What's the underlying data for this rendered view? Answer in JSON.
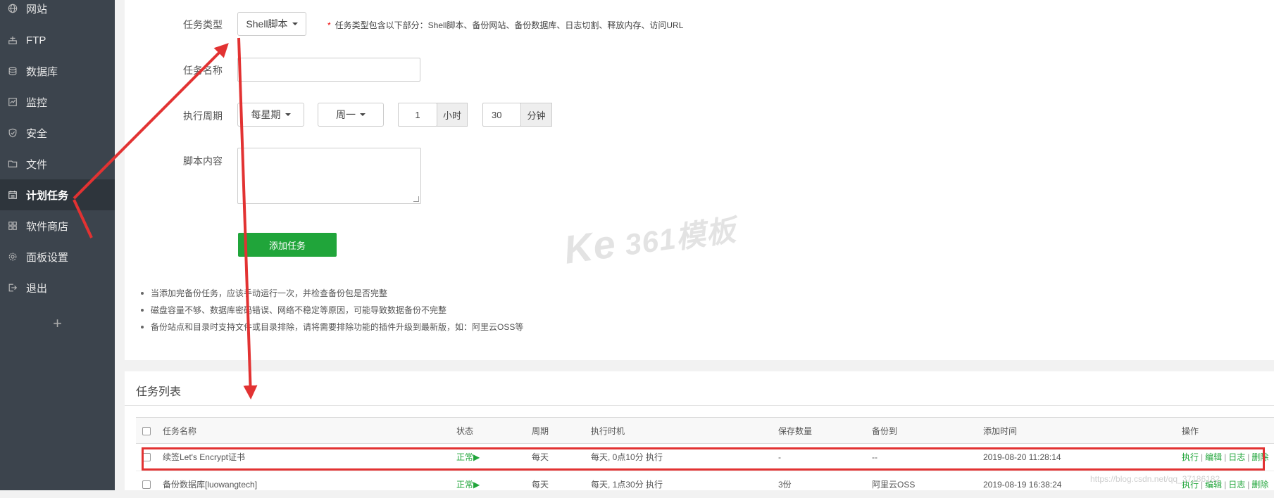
{
  "sidebar": {
    "items": [
      {
        "label": "网站",
        "icon": "globe-icon"
      },
      {
        "label": "FTP",
        "icon": "ftp-icon"
      },
      {
        "label": "数据库",
        "icon": "database-icon"
      },
      {
        "label": "监控",
        "icon": "monitor-icon"
      },
      {
        "label": "安全",
        "icon": "shield-icon"
      },
      {
        "label": "文件",
        "icon": "folder-icon"
      },
      {
        "label": "计划任务",
        "icon": "calendar-icon",
        "active": true
      },
      {
        "label": "软件商店",
        "icon": "apps-icon"
      },
      {
        "label": "面板设置",
        "icon": "gear-icon"
      },
      {
        "label": "退出",
        "icon": "logout-icon"
      }
    ],
    "add_label": "+"
  },
  "form": {
    "task_type_label": "任务类型",
    "task_type_value": "Shell脚本",
    "task_type_hint_star": "*",
    "task_type_hint": "任务类型包含以下部分：Shell脚本、备份网站、备份数据库、日志切割、释放内存、访问URL",
    "task_name_label": "任务名称",
    "task_name_value": "",
    "period_label": "执行周期",
    "period_value": "每星期",
    "weekday_value": "周一",
    "hour_value": "1",
    "hour_unit": "小时",
    "minute_value": "30",
    "minute_unit": "分钟",
    "script_label": "脚本内容",
    "submit_label": "添加任务"
  },
  "notes": [
    "当添加完备份任务，应该手动运行一次，并检查备份包是否完整",
    "磁盘容量不够、数据库密码错误、网络不稳定等原因，可能导致数据备份不完整",
    "备份站点和目录时支持文件或目录排除，请将需要排除功能的插件升级到最新版，如：阿里云OSS等"
  ],
  "watermark": {
    "ke": "Ke",
    "text": "361模板"
  },
  "task_list": {
    "title": "任务列表",
    "columns": [
      "任务名称",
      "状态",
      "周期",
      "执行时机",
      "保存数量",
      "备份到",
      "添加时间",
      "操作"
    ],
    "rows": [
      {
        "name": "续签Let's Encrypt证书",
        "status": "正常▶",
        "cycle": "每天",
        "timing": "每天, 0点10分 执行",
        "keep": "-",
        "backup_to": "--",
        "added": "2019-08-20 11:28:14",
        "ops": [
          "执行",
          "编辑",
          "日志",
          "删除"
        ]
      },
      {
        "name": "备份数据库[luowangtech]",
        "status": "正常▶",
        "cycle": "每天",
        "timing": "每天, 1点30分 执行",
        "keep": "3份",
        "backup_to": "阿里云OSS",
        "added": "2019-08-19 16:38:24",
        "ops": [
          "执行",
          "编辑",
          "日志",
          "删除"
        ]
      }
    ]
  },
  "blog_watermark": "https://blog.csdn.net/qq_37186182",
  "colors": {
    "sidebar_bg": "#3c444d",
    "accent_green": "#20a53a",
    "highlight_red": "#e23232"
  }
}
